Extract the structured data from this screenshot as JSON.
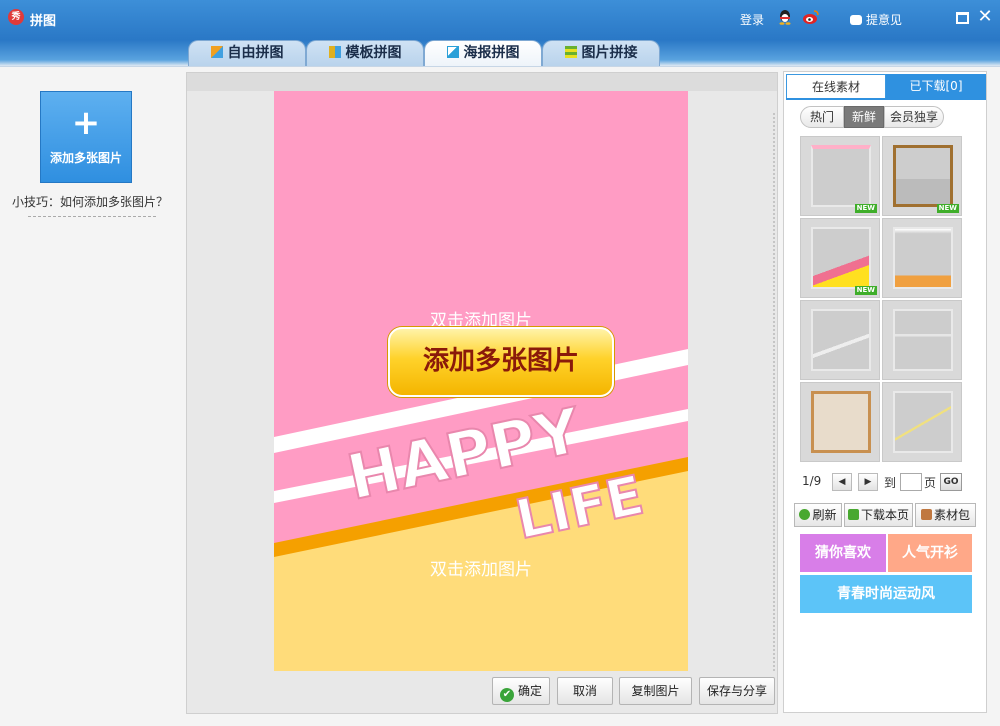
{
  "app": {
    "title": "拼图",
    "logo_text": "秀",
    "login": "登录",
    "feedback": "提意见"
  },
  "tabs": [
    {
      "label": "自由拼图",
      "color": "#f0a020"
    },
    {
      "label": "模板拼图",
      "color": "#e0b020"
    },
    {
      "label": "海报拼图",
      "color": "#2aa0d8"
    },
    {
      "label": "图片拼接",
      "color": "#68b030"
    }
  ],
  "left": {
    "add_label": "添加多张图片",
    "plus": "+",
    "tip": "小技巧：如何添加多张图片？"
  },
  "poster": {
    "top_hint": "双击添加图片",
    "bottom_hint": "双击添加图片",
    "add_button": "添加多张图片",
    "word1": "HAPPY",
    "word2": "LIFE",
    "colors": {
      "pink": "#ff9cc4",
      "yellow": "#ffdc7a",
      "orange": "#f5a000"
    }
  },
  "actions": {
    "confirm": "确定",
    "cancel": "取消",
    "copy": "复制图片",
    "save_share": "保存与分享"
  },
  "right": {
    "tab_online": "在线素材",
    "tab_downloaded": "已下载[0]",
    "filters": [
      "热门",
      "新鲜",
      "会员独享"
    ],
    "active_filter": "新鲜",
    "new_tag": "NEW",
    "pager": {
      "current": "1/9",
      "to": "到",
      "page": "页",
      "go": "GO"
    },
    "buttons": {
      "refresh": "刷新",
      "download_page": "下载本页",
      "material_pack": "素材包"
    },
    "banners": {
      "guess": "猜你喜欢",
      "popular": "人气开衫",
      "youth": "青春时尚运动风"
    }
  }
}
